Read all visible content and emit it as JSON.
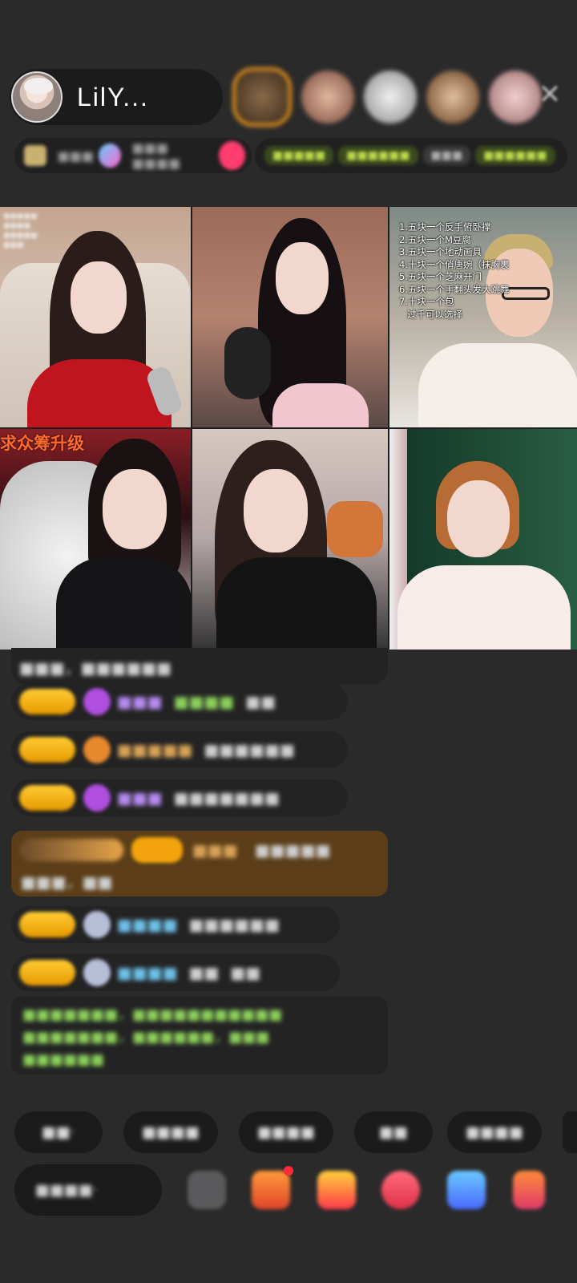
{
  "host": {
    "name": "LilY..."
  },
  "video_grid": {
    "tile3_overlay_lines": [
      "1.五块一个反手俯卧撑",
      "2.五块一个M豆腐",
      "3.五块一个地动画具",
      "4.十块一个俏唐婉（抹胸裹",
      "5.五块一个芝麻开门",
      "6.五块一个手翻头发大跳舞",
      "7.十块一个包",
      "过千可以选择"
    ],
    "tile4_banner": "求众筹升级"
  },
  "colors": {
    "background": "#2a2a2b",
    "level_badge": "#ffcc33",
    "gift_message_bg": "#5b3e18",
    "close_icon": "#bbbbbb"
  }
}
